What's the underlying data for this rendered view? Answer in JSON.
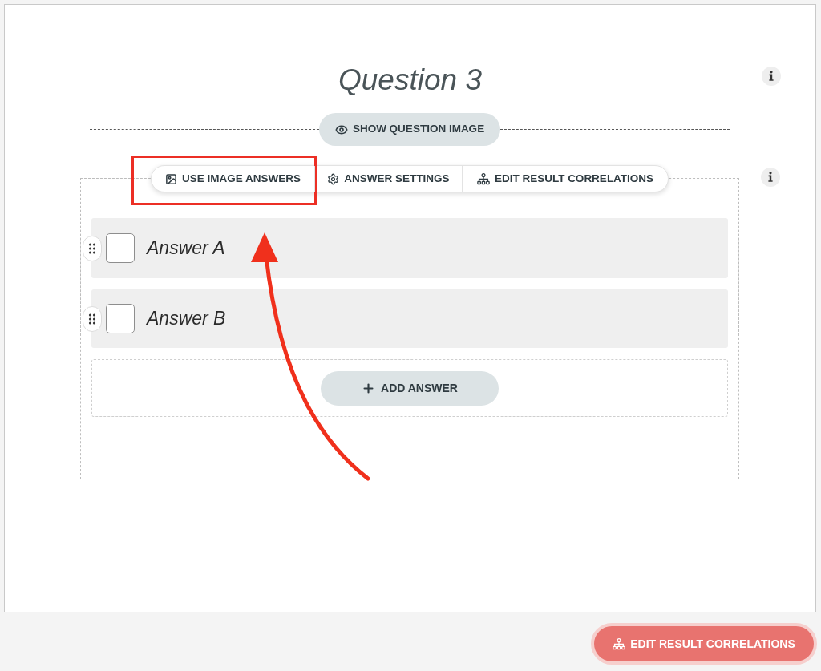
{
  "question": {
    "title": "Question 3"
  },
  "question_image_button": {
    "label": "SHOW QUESTION IMAGE"
  },
  "answer_toolbar": [
    {
      "kind": "image",
      "label": "USE IMAGE ANSWERS",
      "highlighted": true
    },
    {
      "kind": "settings",
      "label": "ANSWER SETTINGS",
      "highlighted": false
    },
    {
      "kind": "correlations",
      "label": "EDIT RESULT CORRELATIONS",
      "highlighted": false
    }
  ],
  "answers": [
    {
      "text": "Answer A",
      "checked": false
    },
    {
      "text": "Answer B",
      "checked": false
    }
  ],
  "add_answer_button": {
    "label": "ADD ANSWER"
  },
  "footer_button": {
    "label": "EDIT RESULT CORRELATIONS"
  }
}
